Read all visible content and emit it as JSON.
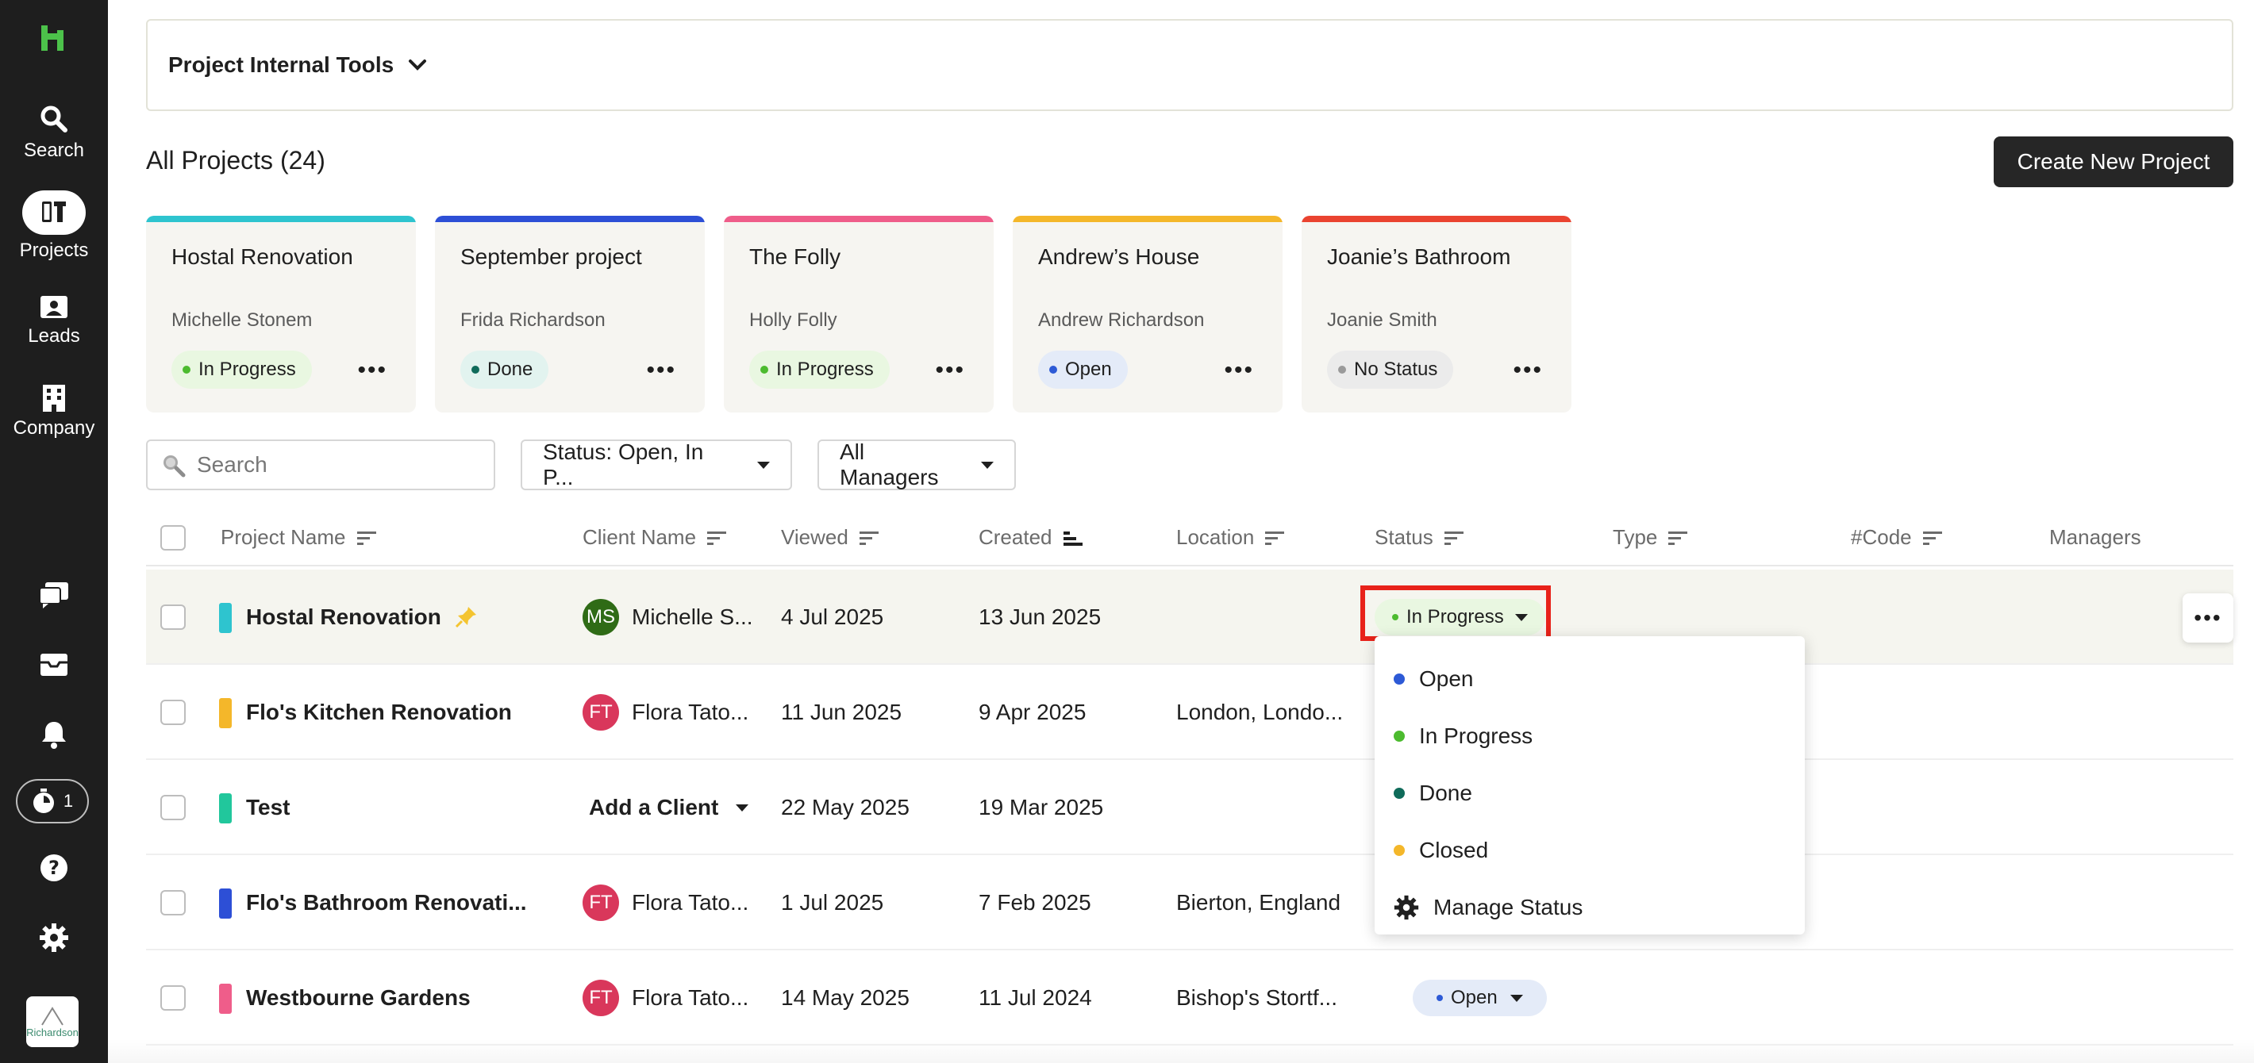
{
  "sidebar": {
    "nav": [
      {
        "label": "Search",
        "icon": "search-icon"
      },
      {
        "label": "Projects",
        "icon": "projects-icon"
      },
      {
        "label": "Leads",
        "icon": "leads-icon"
      },
      {
        "label": "Company",
        "icon": "company-icon"
      }
    ],
    "timer_count": "1",
    "company_logo_text": "Richardson"
  },
  "workspace": {
    "name": "Project Internal Tools"
  },
  "page": {
    "title": "All Projects (24)",
    "create_button": "Create New Project"
  },
  "cards": [
    {
      "title": "Hostal Renovation",
      "client": "Michelle Stonem",
      "status": "In Progress",
      "accent": "#2ec4cf",
      "status_color": "#4cbb2f",
      "chip_bg": "#e9f7e1"
    },
    {
      "title": "September project",
      "client": "Frida Richardson",
      "status": "Done",
      "accent": "#2d4fd6",
      "status_color": "#0f6b5a",
      "chip_bg": "#e2f3ef"
    },
    {
      "title": "The Folly",
      "client": "Holly Folly",
      "status": "In Progress",
      "accent": "#ef5d8a",
      "status_color": "#4cbb2f",
      "chip_bg": "#e9f7e1"
    },
    {
      "title": "Andrew’s House",
      "client": "Andrew Richardson",
      "status": "Open",
      "accent": "#f4b72a",
      "status_color": "#2d5ad6",
      "chip_bg": "#e4ebf8"
    },
    {
      "title": "Joanie’s Bathroom",
      "client": "Joanie Smith",
      "status": "No Status",
      "accent": "#ea4330",
      "status_color": "#9a9a9a",
      "chip_bg": "#ebebeb"
    }
  ],
  "filters": {
    "search_placeholder": "Search",
    "status_filter": "Status: Open, In P...",
    "manager_filter": "All Managers"
  },
  "table": {
    "columns": [
      "Project Name",
      "Client Name",
      "Viewed",
      "Created",
      "Location",
      "Status",
      "Type",
      "#Code",
      "Managers"
    ],
    "rows": [
      {
        "name": "Hostal Renovation",
        "color": "#2ec4cf",
        "pinned": true,
        "client": "Michelle S...",
        "initials": "MS",
        "avatar_color": "#2f6b16",
        "viewed": "4 Jul 2025",
        "created": "13 Jun 2025",
        "location": "",
        "status": "In Progress"
      },
      {
        "name": "Flo's Kitchen Renovation",
        "color": "#f4b72a",
        "client": "Flora Tato...",
        "initials": "FT",
        "avatar_color": "#d9375b",
        "viewed": "11 Jun 2025",
        "created": "9 Apr 2025",
        "location": "London, Londo..."
      },
      {
        "name": "Test",
        "color": "#21c79c",
        "client": "Add a Client",
        "initials": "",
        "viewed": "22 May 2025",
        "created": "19 Mar 2025",
        "location": ""
      },
      {
        "name": "Flo's Bathroom Renovati...",
        "color": "#2d4fd6",
        "client": "Flora Tato...",
        "initials": "FT",
        "avatar_color": "#d9375b",
        "viewed": "1 Jul 2025",
        "created": "7 Feb 2025",
        "location": "Bierton, England"
      },
      {
        "name": "Westbourne Gardens",
        "color": "#ef5d8a",
        "client": "Flora Tato...",
        "initials": "FT",
        "avatar_color": "#d9375b",
        "viewed": "14 May 2025",
        "created": "11 Jul 2024",
        "location": "Bishop's Stortf...",
        "status": "Open"
      }
    ]
  },
  "status_dropdown": {
    "options": [
      {
        "label": "Open",
        "color": "#2d5ad6"
      },
      {
        "label": "In Progress",
        "color": "#4cbb2f"
      },
      {
        "label": "Done",
        "color": "#0f6b5a"
      },
      {
        "label": "Closed",
        "color": "#f4b72a"
      }
    ],
    "manage_label": "Manage Status"
  }
}
